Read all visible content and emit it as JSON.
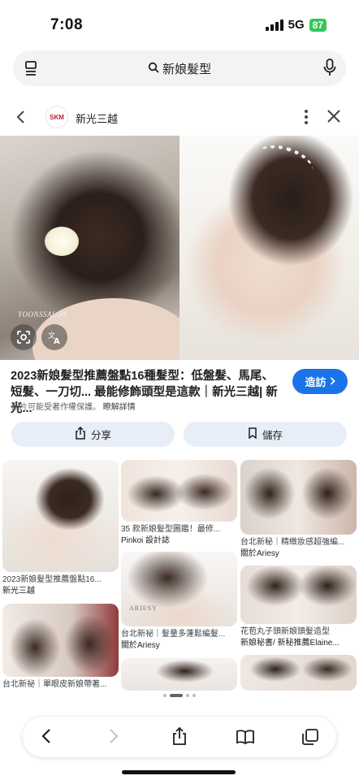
{
  "status": {
    "time": "7:08",
    "network": "5G",
    "battery": "87"
  },
  "search": {
    "query": "新娘髮型"
  },
  "viewer": {
    "site_name": "新光三越",
    "logo_text": "SKM"
  },
  "hero": {
    "watermark": "YOONSSALON"
  },
  "result": {
    "title": "2023新娘髮型推薦盤點16種髮型：低盤髮、馬尾、短髮、一刀切... 最能修飾頭型是這款｜新光三越| 新光...",
    "visit_label": "造訪",
    "copyright_text": "圖片可能受著作權保護。",
    "more_info": "瞭解詳情"
  },
  "actions": {
    "share_label": "分享",
    "save_label": "儲存"
  },
  "grid": {
    "col1": [
      {
        "caption": "2023新娘髮型推薦盤點16...",
        "source": "新光三越"
      },
      {
        "caption": "台北新祕｜單眼皮新娘帶著...",
        "source": ""
      }
    ],
    "col2": [
      {
        "caption": "35 款新娘髮型圖鑑！最修...",
        "source": "Pinkoi 設計誌"
      },
      {
        "caption": "台北新祕｜髮量多蓬鬆編髮...",
        "source": "關於Ariesy",
        "brand": "ARIESY"
      }
    ],
    "col3": [
      {
        "caption": "台北新秘｜精緻妝感超強編...",
        "source": "關於Ariesy"
      },
      {
        "caption": "花苞丸子頭新娘頭髮造型",
        "source": "新娘秘書/ 新秘推薦Elaine..."
      }
    ]
  },
  "colors": {
    "accent": "#1a73e8",
    "chip_bg": "#e8eef7",
    "battery": "#34c759"
  },
  "icons": {
    "search_bar_left": "tabs-list-icon",
    "search_bar_search": "search-icon",
    "search_bar_right": "microphone-icon",
    "back": "chevron-left-icon",
    "more": "more-vert-icon",
    "close": "close-icon",
    "lens": "lens-icon",
    "translate": "translate-icon",
    "share": "share-icon",
    "save": "bookmark-icon",
    "nav_back": "back-icon",
    "nav_forward": "forward-icon",
    "nav_share": "share-icon",
    "nav_bookmarks": "book-icon",
    "nav_tabs": "tabs-icon"
  }
}
